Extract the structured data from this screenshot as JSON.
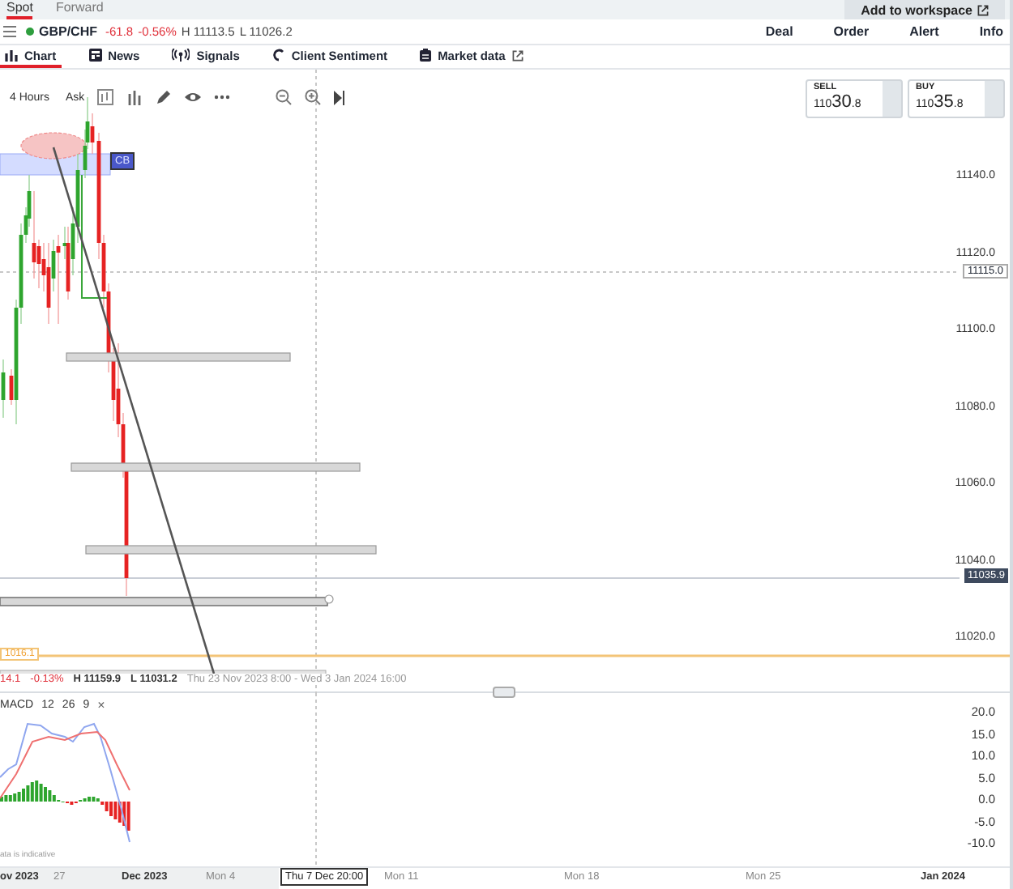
{
  "top_strip": {
    "tabs": [
      {
        "label": "Spot",
        "selected": true
      },
      {
        "label": "Forward",
        "selected": false
      }
    ],
    "button": "Add to workspace"
  },
  "instrument": {
    "symbol": "GBP/CHF",
    "change": "-61.8",
    "change_pct": "-0.56%",
    "high": "H 11113.5",
    "low": "L 11026.2"
  },
  "actions": [
    "Deal",
    "Order",
    "Alert",
    "Info"
  ],
  "tabs": [
    {
      "label": "Chart",
      "selected": true
    },
    {
      "label": "News",
      "selected": false
    },
    {
      "label": "Signals",
      "selected": false
    },
    {
      "label": "Client Sentiment",
      "selected": false
    },
    {
      "label": "Market data",
      "selected": false
    }
  ],
  "chart": {
    "interval": "4 Hours",
    "side": "Ask",
    "sell": {
      "label": "SELL",
      "prefix": "110",
      "big": "30",
      "suffix": ".8"
    },
    "buy": {
      "label": "BUY",
      "prefix": "110",
      "big": "35",
      "suffix": ".8"
    },
    "price_labels": [
      "11140.0",
      "11120.0",
      "11100.0",
      "11080.0",
      "11060.0",
      "11040.0",
      "11020.0"
    ],
    "crosshair_price": "11115.0",
    "current_price": "11035.9",
    "alert_price": "1016.1",
    "zone_label": "CB",
    "info": {
      "change": "14.1",
      "change_pct": "-0.13%",
      "high": "H 11159.9",
      "low": "L 11031.2",
      "range": "Thu 23 Nov 2023 8:00 - Wed 3 Jan 2024 16:00"
    }
  },
  "macd": {
    "title": "MACD",
    "params": [
      "12",
      "26",
      "9"
    ],
    "close": "×",
    "axis": [
      "20.0",
      "15.0",
      "10.0",
      "5.0",
      "0.0",
      "-5.0",
      "-10.0"
    ],
    "note": "ata is indicative"
  },
  "x_axis": [
    {
      "text": "ov 2023",
      "kind": "month"
    },
    {
      "text": "27",
      "kind": "day"
    },
    {
      "text": "Dec 2023",
      "kind": "month"
    },
    {
      "text": "Mon 4",
      "kind": "day"
    },
    {
      "text": "Thu 7 Dec 20:00",
      "kind": "crosshair"
    },
    {
      "text": "Mon 11",
      "kind": "day"
    },
    {
      "text": "Mon 18",
      "kind": "day"
    },
    {
      "text": "Mon 25",
      "kind": "day"
    },
    {
      "text": "Jan 2024",
      "kind": "month"
    }
  ]
}
